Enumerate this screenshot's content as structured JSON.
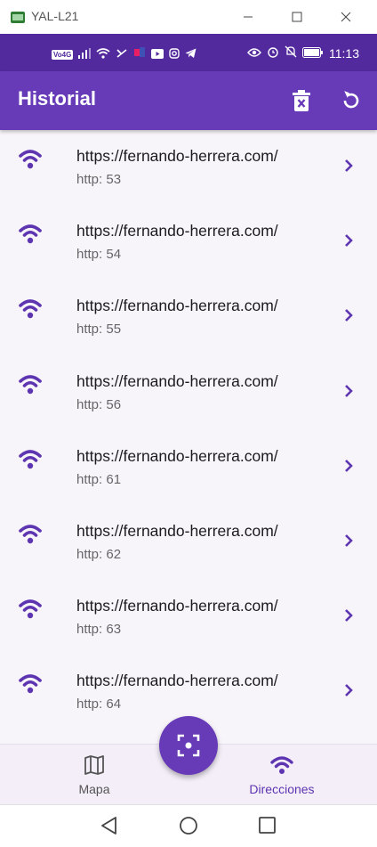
{
  "window": {
    "title": "YAL-L21"
  },
  "status_bar": {
    "badge_text": "Vo4G",
    "time": "11:13"
  },
  "app_bar": {
    "title": "Historial"
  },
  "history": {
    "items": [
      {
        "title": "https://fernando-herrera.com/",
        "subtitle": "http: 53"
      },
      {
        "title": "https://fernando-herrera.com/",
        "subtitle": "http: 54"
      },
      {
        "title": "https://fernando-herrera.com/",
        "subtitle": "http: 55"
      },
      {
        "title": "https://fernando-herrera.com/",
        "subtitle": "http: 56"
      },
      {
        "title": "https://fernando-herrera.com/",
        "subtitle": "http: 61"
      },
      {
        "title": "https://fernando-herrera.com/",
        "subtitle": "http: 62"
      },
      {
        "title": "https://fernando-herrera.com/",
        "subtitle": "http: 63"
      },
      {
        "title": "https://fernando-herrera.com/",
        "subtitle": "http: 64"
      }
    ]
  },
  "bottom_nav": {
    "items": [
      {
        "label": "Mapa",
        "icon": "map-icon",
        "active": false
      },
      {
        "label": "Direcciones",
        "icon": "wifi-icon",
        "active": true
      }
    ]
  },
  "colors": {
    "primary": "#673ab7",
    "status_bar": "#532a9e",
    "active_label": "#5e35b1",
    "inactive_label": "#555555"
  }
}
